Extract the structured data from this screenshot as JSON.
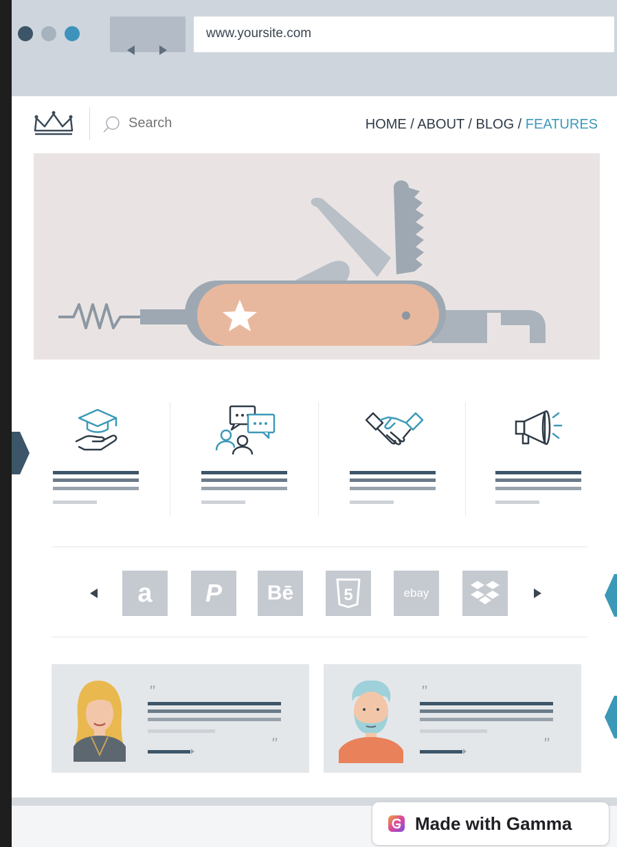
{
  "browser": {
    "url": "www.yoursite.com",
    "dot_colors": [
      "#3c5568",
      "#a6b2bd",
      "#3e93bd"
    ]
  },
  "site": {
    "search_placeholder": "Search",
    "nav": {
      "items": [
        "HOME",
        "ABOUT",
        "BLOG"
      ],
      "separator": " / ",
      "active": "FEATURES"
    },
    "accent_color": "#3b99b8",
    "features": [
      {
        "icon": "graduation-cap-hand-icon"
      },
      {
        "icon": "discussion-chat-icon"
      },
      {
        "icon": "handshake-icon"
      },
      {
        "icon": "megaphone-icon"
      }
    ],
    "logos": [
      {
        "icon": "amazon-logo-icon",
        "label": "a"
      },
      {
        "icon": "paypal-logo-icon",
        "label": "P"
      },
      {
        "icon": "behance-logo-icon",
        "label": "Bē"
      },
      {
        "icon": "html5-logo-icon",
        "label": "5"
      },
      {
        "icon": "ebay-logo-icon",
        "label": "ebay"
      },
      {
        "icon": "dropbox-logo-icon",
        "label": ""
      }
    ],
    "testimonials": [
      {
        "avatar": "woman-avatar-icon",
        "open_quote": "\"",
        "close_quote": "\""
      },
      {
        "avatar": "man-avatar-icon",
        "open_quote": "\"",
        "close_quote": "\""
      }
    ]
  },
  "badge": {
    "label": "Made with Gamma",
    "icon": "gamma-logo-icon"
  }
}
